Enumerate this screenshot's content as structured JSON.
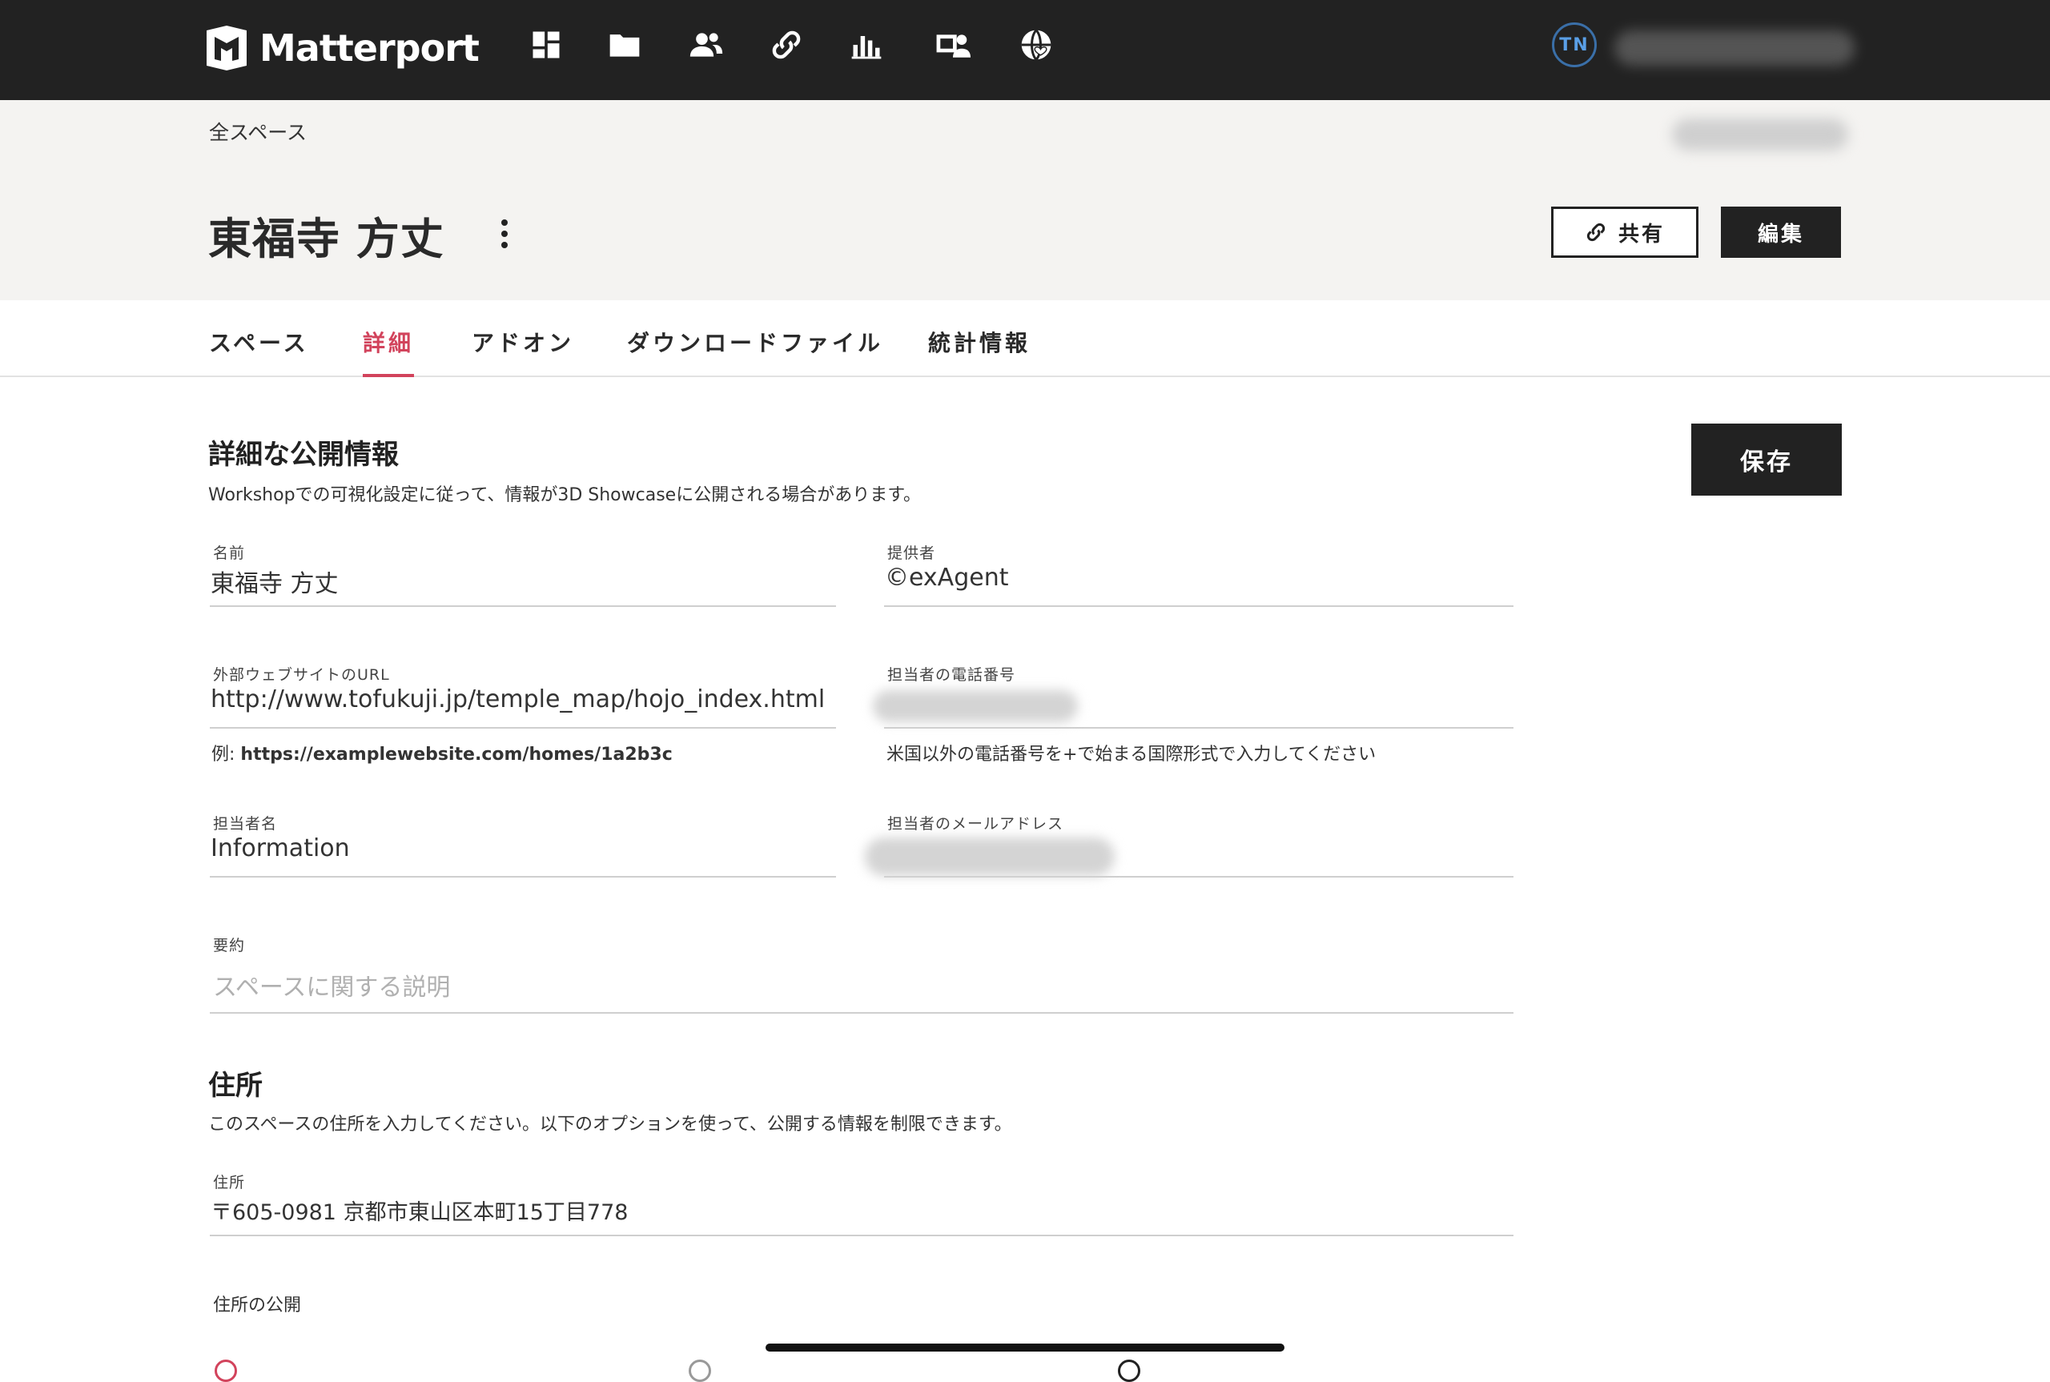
{
  "app": {
    "logo_text": "Matterport"
  },
  "topbar": {
    "nav_icons": [
      "dashboard-icon",
      "folder-icon",
      "users-icon",
      "link-icon",
      "bar-chart-icon",
      "photo-person-icon",
      "globe-icon"
    ],
    "user_initials": "TN"
  },
  "header": {
    "breadcrumb": "全スペース",
    "space_title": "東福寺 方丈",
    "share_label": "共有",
    "edit_label": "編集"
  },
  "tabs": [
    {
      "label": "スペース",
      "active": false
    },
    {
      "label": "詳細",
      "active": true
    },
    {
      "label": "アドオン",
      "active": false
    },
    {
      "label": "ダウンロードファイル",
      "active": false
    },
    {
      "label": "統計情報",
      "active": false
    }
  ],
  "details": {
    "title": "詳細な公開情報",
    "description": "Workshopでの可視化設定に従って、情報が3D Showcaseに公開される場合があります。",
    "save_label": "保存",
    "fields": {
      "name": {
        "label": "名前",
        "value": "東福寺 方丈"
      },
      "provider": {
        "label": "提供者",
        "value": "©exAgent"
      },
      "url": {
        "label": "外部ウェブサイトのURL",
        "value": "http://www.tofukuji.jp/temple_map/hojo_index.html",
        "helper_prefix": "例: ",
        "helper_example": "https://examplewebsite.com/homes/1a2b3c"
      },
      "phone": {
        "label": "担当者の電話番号",
        "value": "",
        "helper": "米国以外の電話番号を+で始まる国際形式で入力してください"
      },
      "contact_name": {
        "label": "担当者名",
        "value": "Information"
      },
      "contact_email": {
        "label": "担当者のメールアドレス",
        "value": ""
      },
      "summary": {
        "label": "要約",
        "value": "",
        "placeholder": "スペースに関する説明"
      }
    }
  },
  "address": {
    "title": "住所",
    "description": "このスペースの住所を入力してください。以下のオプションを使って、公開する情報を制限できます。",
    "field_label": "住所",
    "value": "〒605-0981 京都市東山区本町15丁目778",
    "visibility_label": "住所の公開"
  },
  "colors": {
    "topbar": "#222222",
    "accent": "#d2435c",
    "header_bg": "#f4f3f1",
    "avatar_ring": "#3a6fa8"
  }
}
